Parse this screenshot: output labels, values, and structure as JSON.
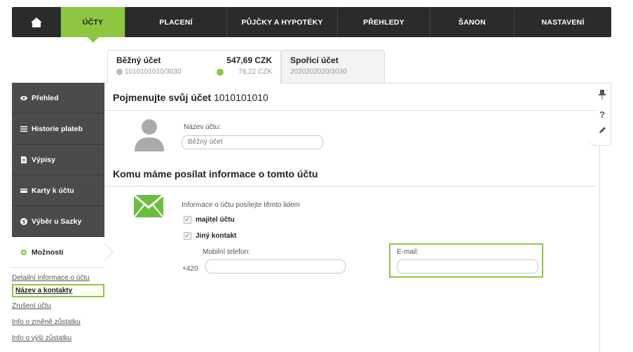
{
  "nav": {
    "home_icon": "home-icon",
    "items": [
      "ÚČTY",
      "PLACENÍ",
      "PŮJČKY A HYPOTÉKY",
      "PŘEHLEDY",
      "ŠANON",
      "NASTAVENÍ"
    ],
    "active_color": "#8dc63f"
  },
  "accounts": [
    {
      "name": "Běžný účet",
      "number": "1010101010/3030",
      "balance": "547,69 CZK",
      "available": "78,22 CZK"
    },
    {
      "name": "Spořicí účet",
      "number": "2020202020/3030"
    }
  ],
  "sidebar": {
    "items": [
      "Přehled",
      "Historie plateb",
      "Výpisy",
      "Karty k účtu",
      "Výběr u Sazky",
      "Možnosti"
    ],
    "sublinks": [
      "Detailní informace o účtu",
      "Název a kontakty",
      "Zrušení účtu",
      "Info o změně zůstatku",
      "Info o výši zůstatku"
    ]
  },
  "main": {
    "title_prefix": "Pojmenujte svůj účet",
    "title_number": "1010101010",
    "name_label": "Název účtu:",
    "name_value": "Běžný účet",
    "section2_title": "Komu máme posílat informace o tomto účtu",
    "info_text": "Informace o účtu posílejte těmto lidem",
    "check_owner": "majitel účtu",
    "check_other": "Jiný kontakt",
    "phone_label": "Mobilní telefon:",
    "phone_prefix": "+420",
    "email_label": "E-mail:"
  },
  "tools": {
    "pin_icon": "pin-icon",
    "help": "?",
    "edit_icon": "pencil-icon"
  }
}
